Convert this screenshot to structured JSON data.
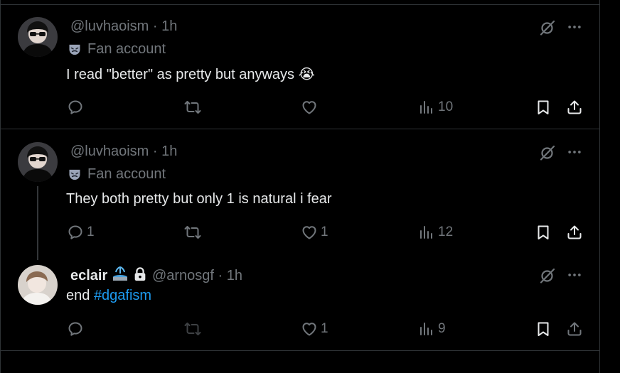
{
  "posts": [
    {
      "handle": "@luvhaoism",
      "time": "1h",
      "badge": "Fan account",
      "text": "I read \"better\" as pretty but anyways",
      "emoji": "😭",
      "replies": "",
      "reposts": "",
      "likes": "",
      "views": "10"
    },
    {
      "handle": "@luvhaoism",
      "time": "1h",
      "badge": "Fan account",
      "text": "They both pretty but only 1 is natural i fear",
      "replies": "1",
      "reposts": "",
      "likes": "1",
      "views": "12"
    },
    {
      "display_name": "eclair",
      "handle": "@arnosgf",
      "time": "1h",
      "text_prefix": "end",
      "hashtag": "#dgafism",
      "replies": "",
      "reposts": "",
      "likes": "1",
      "views": "9"
    }
  ],
  "separator": "·",
  "icons": {
    "badge": "theater-mask-icon",
    "grok": "grok-slash-circle-icon",
    "more": "more-dots-icon",
    "reply": "reply-bubble-icon",
    "repost": "repost-arrows-icon",
    "like": "heart-icon",
    "views": "views-bars-icon",
    "bookmark": "bookmark-icon",
    "share": "share-upload-icon",
    "lock": "lock-icon"
  },
  "colors": {
    "background": "#000000",
    "text": "#e7e9ea",
    "muted": "#71767b",
    "link": "#1d9bf0",
    "border": "#2f3336"
  }
}
